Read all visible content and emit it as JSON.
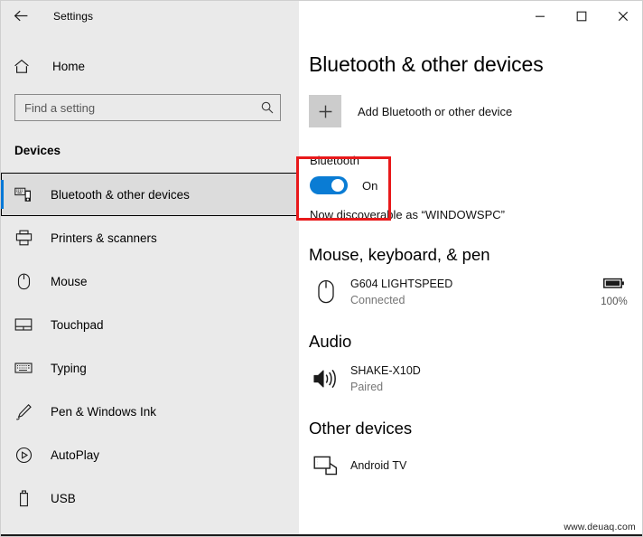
{
  "titlebar": {
    "back_icon": "back-arrow-icon",
    "title": "Settings",
    "minimize_label": "Minimize",
    "maximize_label": "Maximize",
    "close_label": "Close"
  },
  "sidebar": {
    "home": {
      "icon": "home-icon",
      "label": "Home"
    },
    "search": {
      "icon": "search-icon",
      "value": "",
      "placeholder": "Find a setting"
    },
    "section_title": "Devices",
    "items": [
      {
        "label": "Bluetooth & other devices",
        "icon": "bluetooth-devices-icon",
        "selected": true
      },
      {
        "label": "Printers & scanners",
        "icon": "printer-icon",
        "selected": false
      },
      {
        "label": "Mouse",
        "icon": "mouse-icon",
        "selected": false
      },
      {
        "label": "Touchpad",
        "icon": "touchpad-icon",
        "selected": false
      },
      {
        "label": "Typing",
        "icon": "keyboard-icon",
        "selected": false
      },
      {
        "label": "Pen & Windows Ink",
        "icon": "pen-icon",
        "selected": false
      },
      {
        "label": "AutoPlay",
        "icon": "autoplay-icon",
        "selected": false
      },
      {
        "label": "USB",
        "icon": "usb-icon",
        "selected": false
      }
    ]
  },
  "content": {
    "page_title": "Bluetooth & other devices",
    "add_device": {
      "icon": "plus-icon",
      "label": "Add Bluetooth or other device"
    },
    "bluetooth": {
      "label": "Bluetooth",
      "state": "On",
      "toggle_on": true,
      "discoverable_text": "Now discoverable as “WINDOWSPC”",
      "highlight_color": "#e8191b"
    },
    "groups": [
      {
        "title": "Mouse, keyboard, & pen",
        "devices": [
          {
            "name": "G604 LIGHTSPEED",
            "status": "Connected",
            "icon": "mouse-icon",
            "battery_icon": "battery-full-icon",
            "battery": "100%"
          }
        ]
      },
      {
        "title": "Audio",
        "devices": [
          {
            "name": "SHAKE-X10D",
            "status": "Paired",
            "icon": "speaker-icon",
            "battery_icon": "",
            "battery": ""
          }
        ]
      },
      {
        "title": "Other devices",
        "devices": [
          {
            "name": "Android TV",
            "status": "",
            "icon": "tv-icon",
            "battery_icon": "",
            "battery": ""
          }
        ]
      }
    ]
  },
  "watermark": "www.deuaq.com",
  "accent_color": "#0078d7"
}
